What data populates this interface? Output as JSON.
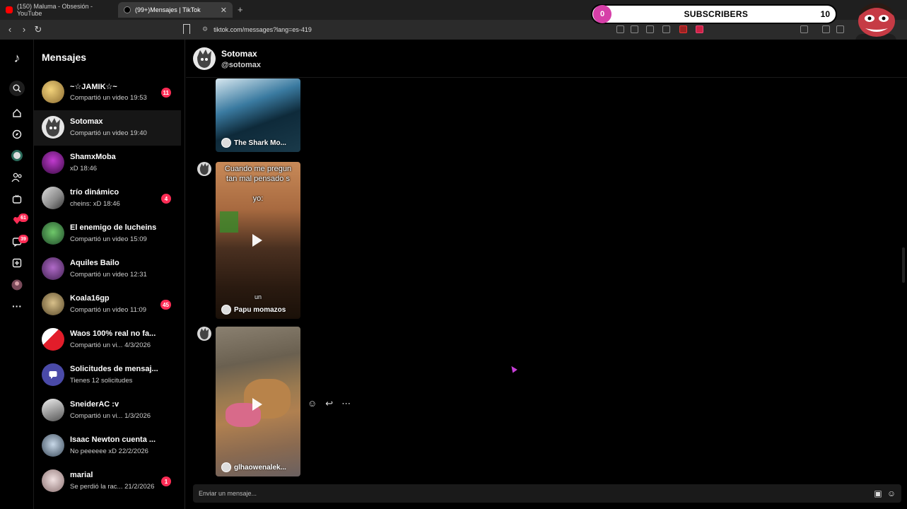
{
  "browser": {
    "tabs": [
      {
        "title": "(150) Maluma - Obsesión - YouTube",
        "icon": "youtube-icon"
      },
      {
        "title": "(99+)Mensajes | TikTok",
        "icon": "tiktok-icon"
      }
    ],
    "new_tab": "+",
    "url": "tiktok.com/messages?lang=es-419"
  },
  "overlay": {
    "subscribers_current": "0",
    "subscribers_label": "SUBSCRIBERS",
    "subscribers_goal": "10"
  },
  "rail": {
    "items": [
      {
        "icon": "tiktok-logo-icon"
      },
      {
        "icon": "search-icon"
      },
      {
        "icon": "home-icon"
      },
      {
        "icon": "explore-icon"
      },
      {
        "icon": "following-icon"
      },
      {
        "icon": "friends-icon"
      },
      {
        "icon": "live-icon"
      },
      {
        "icon": "activity-icon",
        "badge": "61"
      },
      {
        "icon": "messages-icon",
        "badge": "39"
      },
      {
        "icon": "upload-icon"
      },
      {
        "icon": "profile-icon"
      },
      {
        "icon": "more-icon"
      }
    ]
  },
  "sidebar": {
    "title": "Mensajes",
    "conversations": [
      {
        "name": "~☆JAMIK☆~",
        "preview": "Compartió un video 19:53",
        "unread": "11"
      },
      {
        "name": "Sotomax",
        "preview": "Compartió un video 19:40",
        "unread": ""
      },
      {
        "name": "ShamxMoba",
        "preview": "xD 18:46",
        "unread": ""
      },
      {
        "name": "trío dinámico",
        "preview": "cheins: xD 18:46",
        "unread": "4"
      },
      {
        "name": "El enemigo de lucheins",
        "preview": "Compartió un video 15:09",
        "unread": ""
      },
      {
        "name": "Aquiles Bailo",
        "preview": "Compartió un video 12:31",
        "unread": ""
      },
      {
        "name": "Koala16gp",
        "preview": "Compartió un video 11:09",
        "unread": "45"
      },
      {
        "name": "Waos 100% real no fa...",
        "preview": "Compartió un vi... 4/3/2026",
        "unread": ""
      },
      {
        "name": "Solicitudes de mensaj...",
        "preview": "Tienes 12 solicitudes",
        "unread": ""
      },
      {
        "name": "SneiderAC :v",
        "preview": "Compartió un vi... 1/3/2026",
        "unread": ""
      },
      {
        "name": "Isaac Newton cuenta ...",
        "preview": "No peeeeee xD 22/2/2026",
        "unread": ""
      },
      {
        "name": "marial",
        "preview": "Se perdió la rac... 21/2/2026",
        "unread": "1"
      }
    ]
  },
  "chat": {
    "name": "Sotomax",
    "handle": "@sotomax",
    "messages": [
      {
        "caption_top": "",
        "caption_mid": "",
        "credit": "The Shark Mo..."
      },
      {
        "caption_top": "Cuando me pregun",
        "caption_top2": "tan mal pensado s",
        "caption_mid": "yo:",
        "caption_low": "un",
        "credit": "Papu momazos"
      },
      {
        "caption_top": "",
        "caption_mid": "",
        "credit": "glhaowenalek..."
      }
    ],
    "composer_placeholder": "Enviar un mensaje..."
  },
  "colors": {
    "accent": "#fe2c55",
    "background": "#000000",
    "overlay_pink": "#d63fa8"
  }
}
